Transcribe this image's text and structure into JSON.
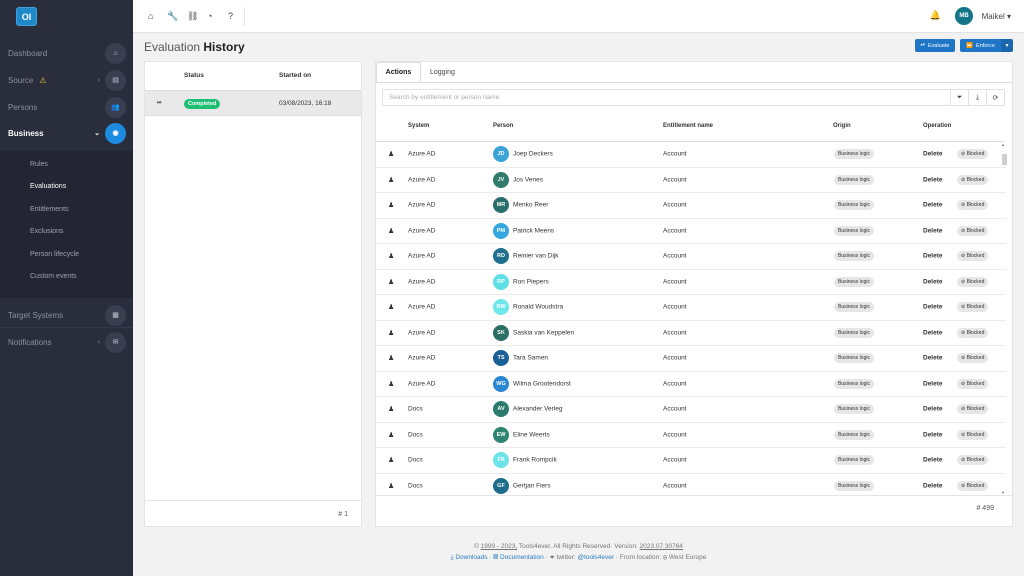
{
  "sidebar": {
    "logo": "OI",
    "items": [
      {
        "label": "Dashboard",
        "icon": "home-icon",
        "glyph": "⌂"
      },
      {
        "label": "Source",
        "icon": "database-icon",
        "glyph": "▤",
        "warning": "⚠",
        "chevron": "‹"
      },
      {
        "label": "Persons",
        "icon": "users-icon",
        "glyph": "👥"
      },
      {
        "label": "Business",
        "icon": "briefcase-icon",
        "glyph": "◉",
        "chevron": "⌄"
      },
      {
        "label": "Target Systems",
        "icon": "grid-icon",
        "glyph": "▦"
      },
      {
        "label": "Notifications",
        "icon": "envelope-icon",
        "glyph": "✉",
        "chevron": "‹"
      }
    ],
    "subitems": [
      "Rules",
      "Evaluations",
      "Entitlements",
      "Exclusions",
      "Person lifecycle",
      "Custom events"
    ]
  },
  "topbar": {
    "icons": [
      "⌂",
      "🔧",
      "⛓",
      "◔",
      "?"
    ],
    "bell": "🔔",
    "avatar": "MB",
    "user": "Maikel ▾"
  },
  "page": {
    "title_light": "Evaluation ",
    "title_bold": "History",
    "evaluate_label": "Evaluate",
    "enforce_label": "Enforce",
    "caret": "▾"
  },
  "history": {
    "col_status": "Status",
    "col_started": "Started on",
    "row": {
      "status": "Completed",
      "started": "03/08/2023, 16:18",
      "play": "⏯"
    },
    "count": "# 1"
  },
  "actions": {
    "tab_actions": "Actions",
    "tab_logging": "Logging",
    "search_placeholder": "Search by entitlement or person name",
    "filter_icon": "⏷",
    "download_icon": "⤓",
    "refresh_icon": "⟳",
    "columns": [
      "System",
      "Person",
      "Entitlement name",
      "Origin",
      "Operation"
    ],
    "rows": [
      {
        "system": "Azure AD",
        "initials": "JD",
        "color": "#3aa3d8",
        "person": "Joep Deckers",
        "entitlement": "Account",
        "origin": "Business logic",
        "operation": "Delete",
        "state": "⊘ Blocked"
      },
      {
        "system": "Azure AD",
        "initials": "JV",
        "color": "#2f7a6b",
        "person": "Jos Venes",
        "entitlement": "Account",
        "origin": "Business logic",
        "operation": "Delete",
        "state": "⊘ Blocked"
      },
      {
        "system": "Azure AD",
        "initials": "MR",
        "color": "#2a6e6a",
        "person": "Menko Reer",
        "entitlement": "Account",
        "origin": "Business logic",
        "operation": "Delete",
        "state": "⊘ Blocked"
      },
      {
        "system": "Azure AD",
        "initials": "PM",
        "color": "#35a7e0",
        "person": "Patrick Meens",
        "entitlement": "Account",
        "origin": "Business logic",
        "operation": "Delete",
        "state": "⊘ Blocked"
      },
      {
        "system": "Azure AD",
        "initials": "RD",
        "color": "#1f6f8f",
        "person": "Reinier van Dijk",
        "entitlement": "Account",
        "origin": "Business logic",
        "operation": "Delete",
        "state": "⊘ Blocked"
      },
      {
        "system": "Azure AD",
        "initials": "RP",
        "color": "#5fe0e6",
        "person": "Ron Piepers",
        "entitlement": "Account",
        "origin": "Business logic",
        "operation": "Delete",
        "state": "⊘ Blocked"
      },
      {
        "system": "Azure AD",
        "initials": "RW",
        "color": "#6ee7ea",
        "person": "Ronald Woudstra",
        "entitlement": "Account",
        "origin": "Business logic",
        "operation": "Delete",
        "state": "⊘ Blocked"
      },
      {
        "system": "Azure AD",
        "initials": "SK",
        "color": "#2a6e64",
        "person": "Saskia van Keppelen",
        "entitlement": "Account",
        "origin": "Business logic",
        "operation": "Delete",
        "state": "⊘ Blocked"
      },
      {
        "system": "Azure AD",
        "initials": "TS",
        "color": "#1a5f96",
        "person": "Tara Samen",
        "entitlement": "Account",
        "origin": "Business logic",
        "operation": "Delete",
        "state": "⊘ Blocked"
      },
      {
        "system": "Azure AD",
        "initials": "WG",
        "color": "#2b86d0",
        "person": "Wilma Grootendorst",
        "entitlement": "Account",
        "origin": "Business logic",
        "operation": "Delete",
        "state": "⊘ Blocked"
      },
      {
        "system": "Docs",
        "initials": "AV",
        "color": "#2a7b6c",
        "person": "Alexander Verleg",
        "entitlement": "Account",
        "origin": "Business logic",
        "operation": "Delete",
        "state": "⊘ Blocked"
      },
      {
        "system": "Docs",
        "initials": "EW",
        "color": "#2d8470",
        "person": "Eline Weerts",
        "entitlement": "Account",
        "origin": "Business logic",
        "operation": "Delete",
        "state": "⊘ Blocked"
      },
      {
        "system": "Docs",
        "initials": "FR",
        "color": "#6ae4e6",
        "person": "Frank Rompcik",
        "entitlement": "Account",
        "origin": "Business logic",
        "operation": "Delete",
        "state": "⊘ Blocked"
      },
      {
        "system": "Docs",
        "initials": "GF",
        "color": "#1c6c8a",
        "person": "Gertjan Fiers",
        "entitlement": "Account",
        "origin": "Business logic",
        "operation": "Delete",
        "state": "⊘ Blocked"
      }
    ],
    "count": "# 499"
  },
  "footer": {
    "copyright_pre": "© ",
    "years": "1999 - 2023,",
    "company": " Tools4ever. All Rights Reserved· Version: ",
    "version": "2023.07.30764",
    "downloads": "⤓ Downloads",
    "documentation": "▤ Documentation",
    "twitter_pre": " · ✦ twitter: ",
    "twitter_handle": "@tools4ever",
    "location": " · From location: ⊕ West Europe",
    "sep": " · "
  }
}
